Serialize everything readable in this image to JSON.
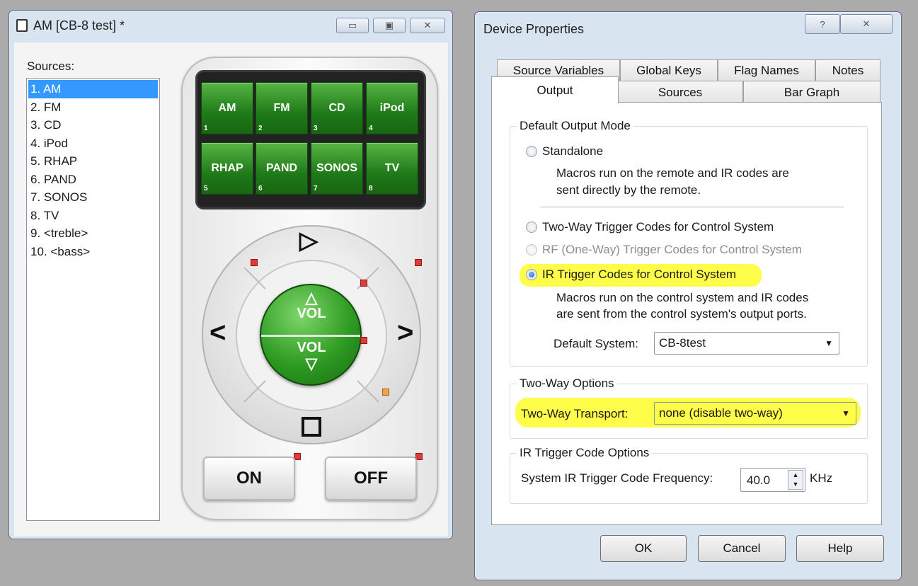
{
  "left_window": {
    "title": "AM [CB-8 test] *",
    "sources_label": "Sources:",
    "sources": [
      "1. AM",
      "2. FM",
      "3. CD",
      "4. iPod",
      "5. RHAP",
      "6. PAND",
      "7. SONOS",
      "8. TV",
      "9. <treble>",
      "10. <bass>"
    ],
    "selected_index": 0,
    "remote": {
      "buttons": [
        {
          "label": "AM",
          "num": "1"
        },
        {
          "label": "FM",
          "num": "2"
        },
        {
          "label": "CD",
          "num": "3"
        },
        {
          "label": "iPod",
          "num": "4"
        },
        {
          "label": "RHAP",
          "num": "5"
        },
        {
          "label": "PAND",
          "num": "6"
        },
        {
          "label": "SONOS",
          "num": "7"
        },
        {
          "label": "TV",
          "num": "8"
        }
      ],
      "vol_up_label": "VOL",
      "vol_down_label": "VOL",
      "on_label": "ON",
      "off_label": "OFF"
    }
  },
  "dialog": {
    "title": "Device Properties",
    "help_glyph": "?",
    "close_glyph": "✕",
    "tabs_row1": [
      "Source Variables",
      "Global Keys",
      "Flag Names",
      "Notes"
    ],
    "tabs_row2": [
      "Output",
      "Sources",
      "Bar Graph"
    ],
    "active_tab": "Output",
    "default_output_mode": {
      "label": "Default Output Mode",
      "standalone": "Standalone",
      "standalone_desc1": "Macros run on the remote and IR codes are",
      "standalone_desc2": "sent directly by the remote.",
      "two_way": "Two-Way Trigger Codes for Control System",
      "rf": "RF (One-Way) Trigger Codes for Control System",
      "ir": "IR Trigger Codes for Control System",
      "ir_desc1": "Macros run on the control system and IR codes",
      "ir_desc2": "are sent from the control system's output ports.",
      "default_system_label": "Default System:",
      "default_system_value": "CB-8test",
      "selected": "ir"
    },
    "two_way_options": {
      "label": "Two-Way Options",
      "transport_label": "Two-Way Transport:",
      "transport_value": "none (disable two-way)"
    },
    "ir_trigger_options": {
      "label": "IR Trigger Code Options",
      "freq_label": "System IR Trigger Code Frequency:",
      "freq_value": "40.0",
      "freq_unit": "KHz"
    },
    "buttons": {
      "ok": "OK",
      "cancel": "Cancel",
      "help": "Help"
    }
  }
}
